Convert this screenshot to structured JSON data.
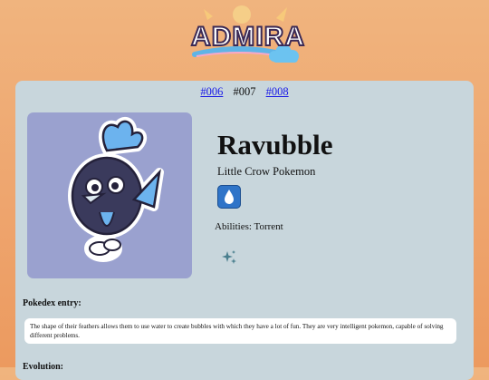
{
  "logo": {
    "text": "ADMIRA",
    "icon": "admira-logo"
  },
  "nav": {
    "prev": "#006",
    "current": "#007",
    "next": "#008"
  },
  "pokemon": {
    "name": "Ravubble",
    "species": "Little Crow Pokemon",
    "type_icon": "water-drop-icon",
    "abilities": "Abilities: Torrent",
    "shiny_icon": "sparkle-icon"
  },
  "pokedex": {
    "label": "Pokedex entry:",
    "entry": "The shape of their feathers allows them to use water to create bubbles with which they have a lot of fun. They are very intelligent pokemon, capable of solving different problems."
  },
  "evolution": {
    "label": "Evolution:"
  },
  "colors": {
    "background": "#eea56e",
    "panel": "#c8d6dc",
    "portrait_bg": "#9aa1cf",
    "water_type": "#2f74c8",
    "link": "#1a1ae6"
  }
}
